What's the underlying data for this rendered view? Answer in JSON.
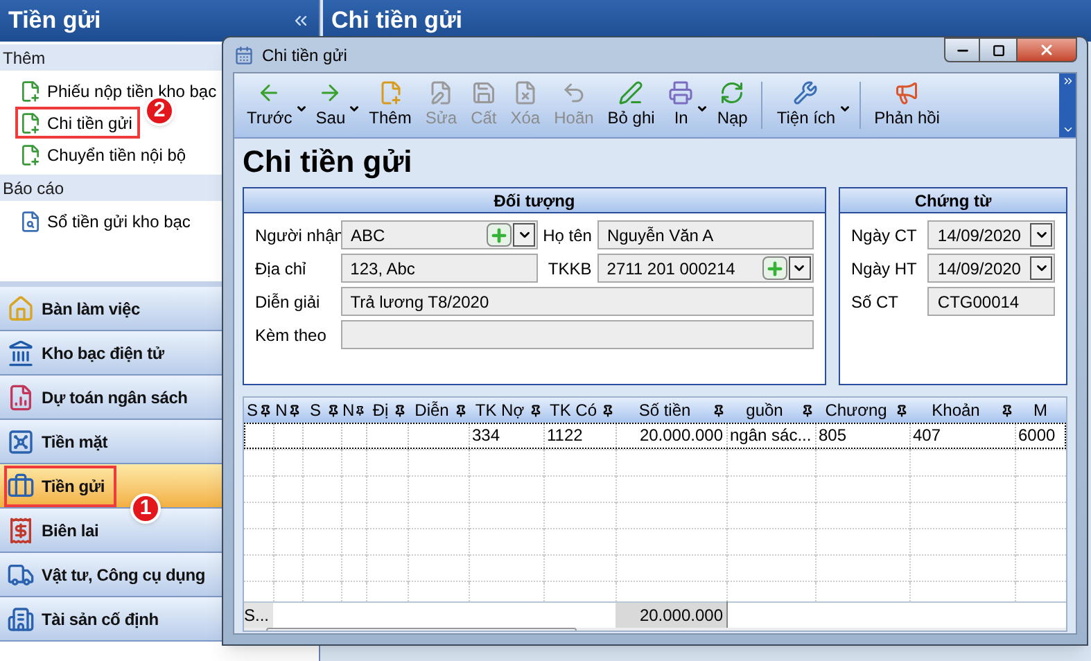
{
  "left_panel": {
    "title": "Tiền gửi",
    "groups": [
      {
        "label": "Thêm",
        "items": [
          {
            "label": "Phiếu nộp tiền kho bạc",
            "highlighted": false
          },
          {
            "label": "Chi tiền gửi",
            "highlighted": true,
            "callout": "2"
          },
          {
            "label": "Chuyển tiền nội bộ",
            "highlighted": false
          }
        ]
      },
      {
        "label": "Báo cáo",
        "items": [
          {
            "label": "Sổ tiền gửi kho bạc",
            "highlighted": false
          }
        ]
      }
    ],
    "nav": [
      {
        "label": "Bàn làm việc",
        "selected": false
      },
      {
        "label": "Kho bạc điện tử",
        "selected": false
      },
      {
        "label": "Dự toán ngân sách",
        "selected": false
      },
      {
        "label": "Tiền mặt",
        "selected": false
      },
      {
        "label": "Tiền gửi",
        "selected": true,
        "callout": "1"
      },
      {
        "label": "Biên lai",
        "selected": false
      },
      {
        "label": "Vật tư, Công cụ dụng",
        "selected": false
      },
      {
        "label": "Tài sản cố định",
        "selected": false
      }
    ]
  },
  "main_header": {
    "title": "Chi tiền gửi"
  },
  "dialog": {
    "title": "Chi tiền gửi",
    "toolbar": [
      {
        "label": "Trước",
        "disabled": false,
        "dropdown": true,
        "separator_after": false
      },
      {
        "label": "Sau",
        "disabled": false,
        "dropdown": true,
        "separator_after": false
      },
      {
        "label": "Thêm",
        "disabled": false,
        "dropdown": false,
        "separator_after": false
      },
      {
        "label": "Sửa",
        "disabled": true,
        "dropdown": false,
        "separator_after": false
      },
      {
        "label": "Cất",
        "disabled": true,
        "dropdown": false,
        "separator_after": false
      },
      {
        "label": "Xóa",
        "disabled": true,
        "dropdown": false,
        "separator_after": false
      },
      {
        "label": "Hoãn",
        "disabled": true,
        "dropdown": false,
        "separator_after": false
      },
      {
        "label": "Bỏ ghi",
        "disabled": false,
        "dropdown": false,
        "separator_after": false
      },
      {
        "label": "In",
        "disabled": false,
        "dropdown": true,
        "separator_after": false
      },
      {
        "label": "Nạp",
        "disabled": false,
        "dropdown": false,
        "separator_after": true
      },
      {
        "label": "Tiện ích",
        "disabled": false,
        "dropdown": true,
        "separator_after": true
      },
      {
        "label": "Phản hồi",
        "disabled": false,
        "dropdown": false,
        "separator_after": false
      }
    ],
    "heading": "Chi tiền gửi",
    "doi_tuong": {
      "title": "Đối tượng",
      "rows": [
        {
          "fields": [
            {
              "label": "Người nhận",
              "value": "ABC",
              "kind": "lookup"
            },
            {
              "label": "Họ tên",
              "value": "Nguyễn Văn A",
              "kind": "text"
            }
          ]
        },
        {
          "fields": [
            {
              "label": "Địa chỉ",
              "value": "123, Abc",
              "kind": "text"
            },
            {
              "label": "TKKB",
              "value": "2711 201 000214",
              "kind": "lookup"
            }
          ]
        },
        {
          "fields": [
            {
              "label": "Diễn giải",
              "value": "Trả lương T8/2020",
              "kind": "text"
            }
          ]
        },
        {
          "fields": [
            {
              "label": "Kèm theo",
              "kind": "text"
            }
          ]
        }
      ]
    },
    "chung_tu": {
      "title": "Chứng từ",
      "fields": [
        {
          "label": "Ngày CT",
          "value": "14/09/2020",
          "kind": "date"
        },
        {
          "label": "Ngày HT",
          "value": "14/09/2020",
          "kind": "date"
        },
        {
          "label": "Số CT",
          "value": "CTG00014",
          "kind": "text"
        }
      ]
    },
    "grid": {
      "columns": [
        {
          "label": "S"
        },
        {
          "label": "N"
        },
        {
          "label": "S"
        },
        {
          "label": "N"
        },
        {
          "label": "Đị"
        },
        {
          "label": "Diễn"
        },
        {
          "label": "TK Nợ"
        },
        {
          "label": "TK Có"
        },
        {
          "label": "Số tiền"
        },
        {
          "label": "guồn"
        },
        {
          "label": "Chương"
        },
        {
          "label": "Khoản"
        },
        {
          "label": "M"
        }
      ],
      "rows": [
        {
          "tk_no": "334",
          "tk_co": "1122",
          "so_tien": "20.000.000",
          "column_10": "ngân sác...",
          "chuong": "805",
          "khoan": "407",
          "column_13": "6000"
        }
      ],
      "footer": {
        "label": "S...",
        "so_tien": "20.000.000"
      }
    }
  }
}
